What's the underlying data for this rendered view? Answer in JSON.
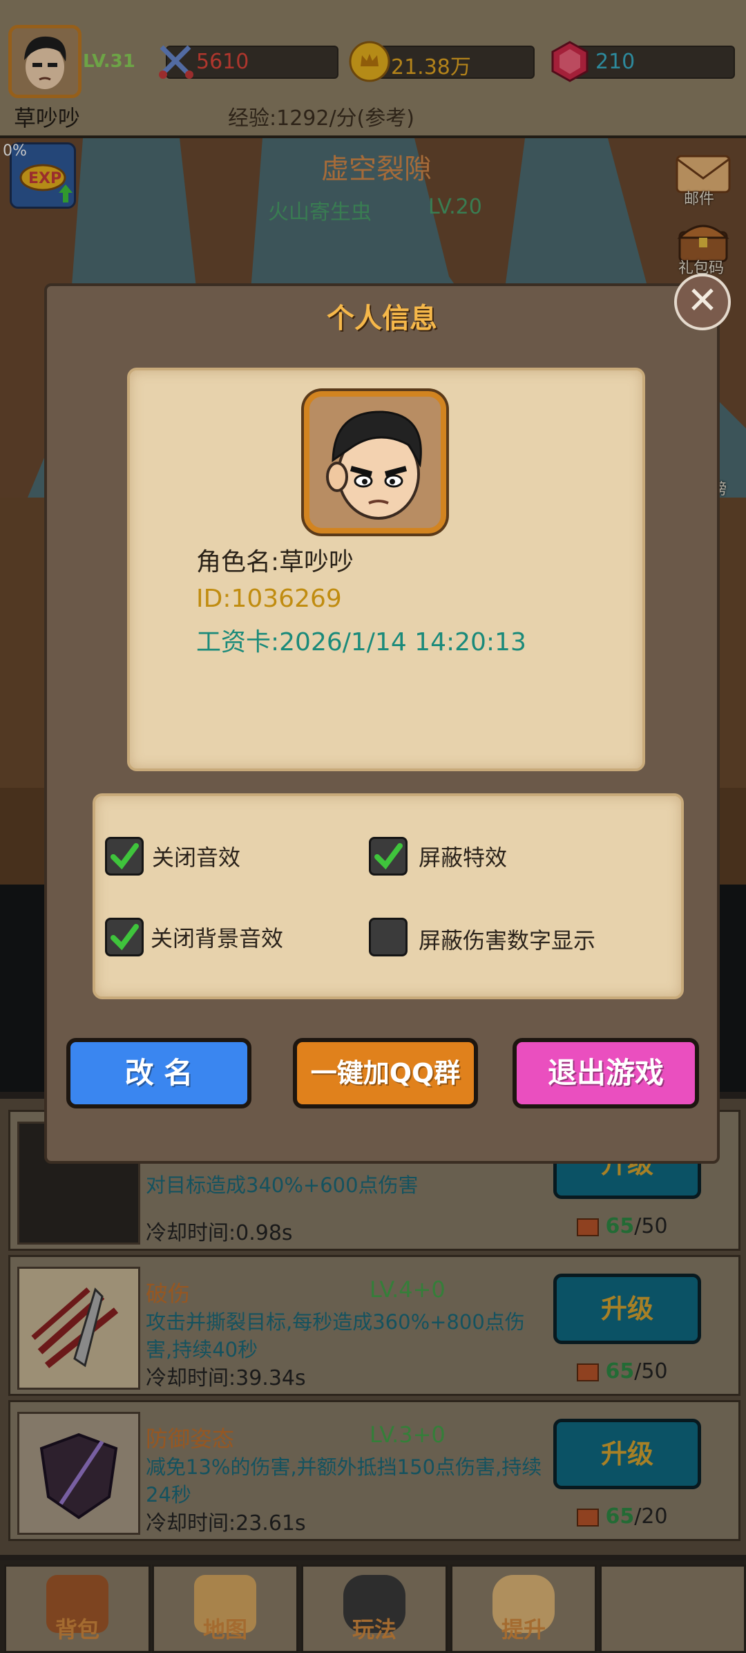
{
  "hud": {
    "level": "LV.31",
    "player_name": "草吵吵",
    "attack": "5610",
    "gold": "21.38万",
    "gems": "210",
    "exp_rate": "经验:1292/分(参考)",
    "exp_boost_percent": "0%"
  },
  "scene": {
    "zone_title": "虚空裂隙",
    "enemy_name": "火山寄生虫",
    "enemy_level": "LV.20",
    "side_mail": "邮件",
    "side_gift": "礼包码",
    "side_rank": "榜"
  },
  "modal": {
    "title": "个人信息",
    "role_name": "角色名:草吵吵",
    "player_id": "ID:1036269",
    "salary_card": "工资卡:2026/1/14 14:20:13",
    "options": [
      {
        "label": "关闭音效",
        "checked": true
      },
      {
        "label": "屏蔽特效",
        "checked": true
      },
      {
        "label": "关闭背景音效",
        "checked": true
      },
      {
        "label": "屏蔽伤害数字显示",
        "checked": false
      }
    ],
    "rename_label": "改 名",
    "qq_group_label": "一键加QQ群",
    "quit_label": "退出游戏"
  },
  "skills": [
    {
      "name": "",
      "level": "",
      "desc": "对目标造成340%+600点伤害",
      "cooldown": "冷却时间:0.98s",
      "upgrade": "升级",
      "cost_have": "65",
      "cost_need": "/50"
    },
    {
      "name": "破伤",
      "level": "LV.4+0",
      "desc": "攻击并撕裂目标,每秒造成360%+800点伤害,持续40秒",
      "cooldown": "冷却时间:39.34s",
      "upgrade": "升级",
      "cost_have": "65",
      "cost_need": "/50"
    },
    {
      "name": "防御姿态",
      "level": "LV.3+0",
      "desc": "减免13%的伤害,并额外抵挡150点伤害,持续24秒",
      "cooldown": "冷却时间:23.61s",
      "upgrade": "升级",
      "cost_have": "65",
      "cost_need": "/20"
    }
  ],
  "nav": [
    {
      "label": "背包",
      "icon": "backpack-icon"
    },
    {
      "label": "地图",
      "icon": "map-icon"
    },
    {
      "label": "玩法",
      "icon": "gamepad-icon"
    },
    {
      "label": "提升",
      "icon": "fist-icon"
    },
    {
      "label": "",
      "icon": ""
    }
  ],
  "colors": {
    "rename": "#3a86f0",
    "qq": "#e0811c",
    "quit": "#ea4fbf",
    "check": "#3fc43c"
  }
}
